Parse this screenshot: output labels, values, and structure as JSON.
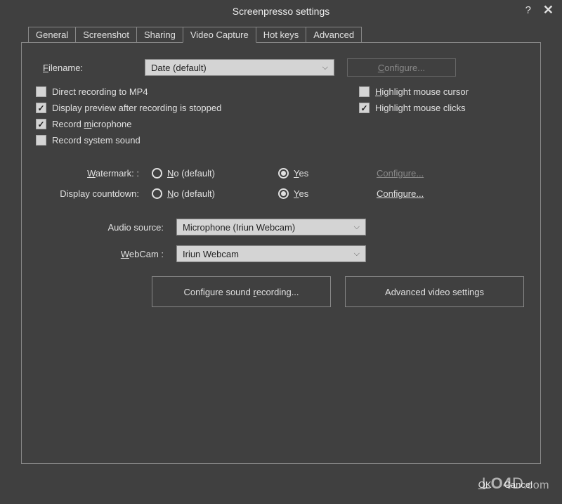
{
  "window": {
    "title": "Screenpresso settings"
  },
  "tabs": {
    "general": "General",
    "screenshot": "Screenshot",
    "sharing": "Sharing",
    "video_capture": "Video Capture",
    "hot_keys": "Hot keys",
    "advanced": "Advanced"
  },
  "filename": {
    "label_prefix": "F",
    "label_rest": "ilename:",
    "selected": "Date (default)",
    "configure_prefix": "C",
    "configure_rest": "onfigure..."
  },
  "checkboxes": {
    "direct_mp4": {
      "label": "Direct recording to MP4",
      "checked": false
    },
    "display_preview": {
      "label": "Display preview after recording is stopped",
      "checked": true
    },
    "record_mic": {
      "prefix": "Record ",
      "u": "m",
      "rest": "icrophone",
      "checked": true
    },
    "record_system": {
      "label": "Record system sound",
      "checked": false
    },
    "highlight_cursor": {
      "prefix": "H",
      "rest": "ighlight mouse cursor",
      "checked": false
    },
    "highlight_clicks": {
      "label": "Highlight mouse clicks",
      "checked": true
    }
  },
  "watermark_opt": {
    "label_prefix": "W",
    "label_rest": "atermark: :",
    "no_prefix": "N",
    "no_rest": "o (default)",
    "yes_prefix": "Y",
    "yes_rest": "es",
    "configure_prefix": "C",
    "configure_rest": "onfigure..."
  },
  "countdown": {
    "label": "Display countdown:",
    "no_prefix": "N",
    "no_rest": "o (default)",
    "yes_prefix": "Y",
    "yes_rest": "es",
    "configure_prefix": "C",
    "configure_rest": "onfigure..."
  },
  "audio_source": {
    "label": "Audio source:",
    "selected": "Microphone (Iriun Webcam)"
  },
  "webcam": {
    "label_prefix": "W",
    "label_rest": "ebCam :",
    "selected": "Iriun Webcam"
  },
  "buttons": {
    "config_sound_prefix": "Configure sound ",
    "config_sound_u": "r",
    "config_sound_rest": "ecording...",
    "adv_video": "Advanced video settings",
    "ok_prefix": "O",
    "ok_rest": "K",
    "cancel": "Cancel"
  },
  "brand": "LO4D.com"
}
